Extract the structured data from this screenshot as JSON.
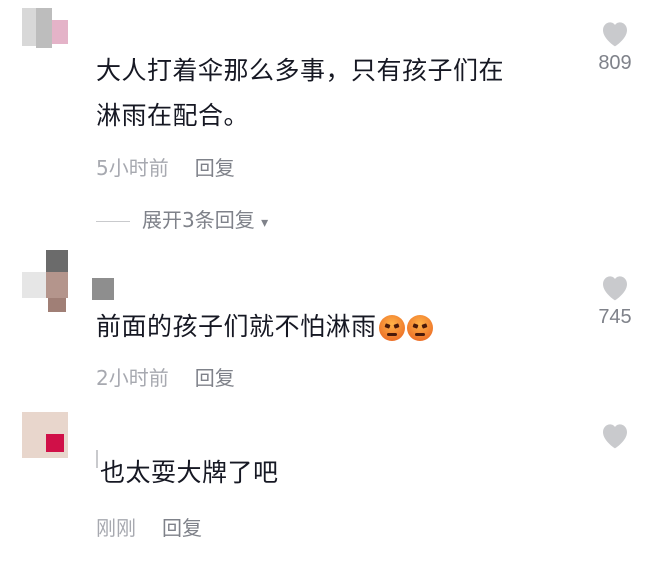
{
  "comments": [
    {
      "text_line1": "大人打着伞那么多事，只有孩子们在",
      "text_line2": "淋雨在配合。",
      "time": "5小时前",
      "reply_label": "回复",
      "likes": "809",
      "expand_label": "展开3条回复",
      "expand_arrow": "▾"
    },
    {
      "text": "前面的孩子们就不怕淋雨",
      "emoji": [
        "angry-face-icon",
        "angry-face-icon"
      ],
      "time": "2小时前",
      "reply_label": "回复",
      "likes": "745"
    },
    {
      "text": "也太耍大牌了吧",
      "time": "刚刚",
      "reply_label": "回复",
      "likes": ""
    }
  ],
  "colors": {
    "text": "#161823",
    "meta": "#a7a9b0",
    "reply": "#7f828a",
    "heart": "#c9cacd"
  }
}
